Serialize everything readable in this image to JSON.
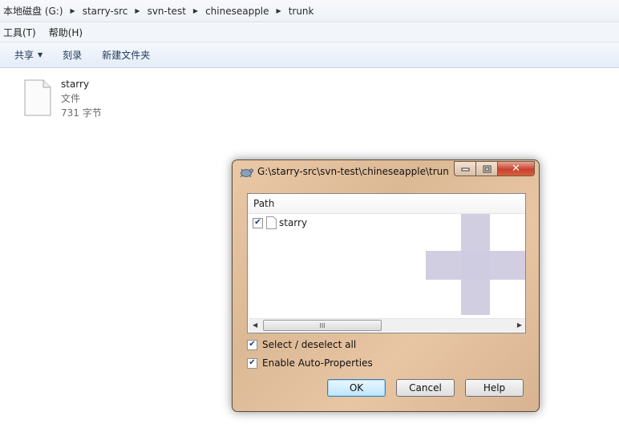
{
  "explorer": {
    "breadcrumb": [
      "本地磁盘 (G:)",
      "starry-src",
      "svn-test",
      "chineseapple",
      "trunk"
    ],
    "menu": {
      "tools": "工具(T)",
      "help": "帮助(H)"
    },
    "toolbar": {
      "share": "共享",
      "burn": "刻录",
      "new_folder": "新建文件夹"
    },
    "file": {
      "name": "starry",
      "type": "文件",
      "size": "731 字节"
    }
  },
  "dialog": {
    "title": "G:\\starry-src\\svn-test\\chineseapple\\trun...",
    "list": {
      "column_header": "Path",
      "rows": [
        {
          "label": "starry",
          "checked": true
        }
      ]
    },
    "scroll_grip": "III",
    "options": {
      "select_all": "Select / deselect all",
      "auto_props": "Enable Auto-Properties"
    },
    "buttons": {
      "ok": "OK",
      "cancel": "Cancel",
      "help": "Help"
    }
  },
  "icons": [
    "chevron-right-icon",
    "chevron-down-icon",
    "file-icon",
    "tortoise-icon",
    "minimize-icon",
    "maximize-icon",
    "close-icon",
    "checkbox-check-icon",
    "plus-overlay-icon"
  ]
}
